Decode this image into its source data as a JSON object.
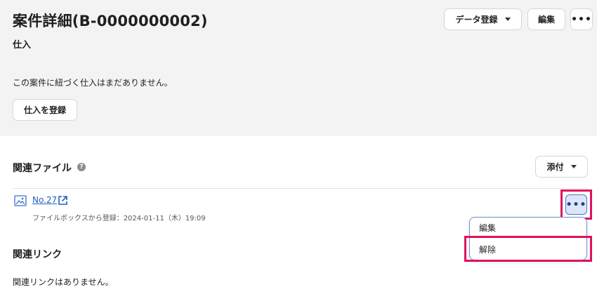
{
  "header": {
    "title": "案件詳細(B-0000000002)",
    "data_register_label": "データ登録",
    "edit_label": "編集",
    "more_label": "•••"
  },
  "purchase": {
    "title": "仕入",
    "empty_message": "この案件に紐づく仕入はまだありません。",
    "register_button": "仕入を登録"
  },
  "files": {
    "title": "関連ファイル",
    "help": "?",
    "attach_label": "添付",
    "items": [
      {
        "name": "No.27",
        "meta": "ファイルボックスから登録：2024-01-11（木）19:09",
        "more_label": "•••"
      }
    ]
  },
  "context_menu": {
    "items": [
      {
        "label": "編集"
      },
      {
        "label": "解除"
      }
    ]
  },
  "links": {
    "title": "関連リンク",
    "empty_message": "関連リンクはありません。"
  },
  "colors": {
    "highlight": "#e0115f",
    "link": "#1e5fc4",
    "header_bg": "#f4f3f3"
  }
}
